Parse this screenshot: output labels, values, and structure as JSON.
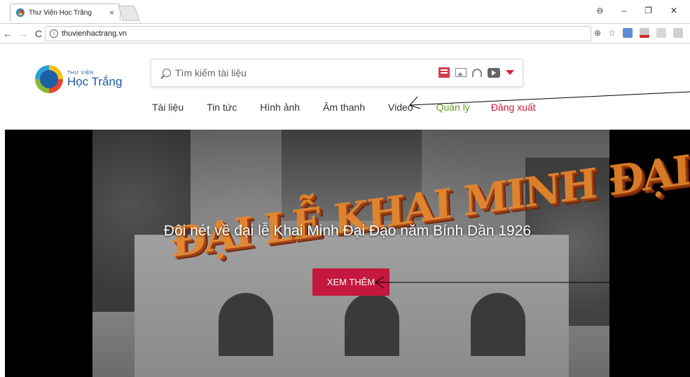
{
  "browser": {
    "tab_title": "Thư Viện Học Trắng",
    "tab_close": "×",
    "url": "thuvienhactrang.vn",
    "win_buttons": [
      "⊖",
      "–",
      "❐",
      "✕"
    ]
  },
  "site": {
    "logo_small": "THƯ VIỆN",
    "logo_big": "Học Trắng",
    "search_placeholder": "Tìm kiếm tài liệu",
    "nav": {
      "docs": "Tài liệu",
      "news": "Tin tức",
      "images": "Hình ảnh",
      "audio": "Âm thanh",
      "video": "Video",
      "manage": "Quản lý",
      "logout": "Đăng xuất"
    },
    "hero": {
      "wordart": "ĐẠI LỄ KHAI MINH ĐẠI ĐẠO",
      "title": "Đôi nét về đại lễ Khai Minh Đại Đạo năm Bính Dần 1926",
      "button": "XEM THÊM"
    }
  },
  "colors": {
    "accent_red": "#c4183f",
    "manage_green": "#6a9c1f",
    "logout_red": "#c81e3d",
    "logo_blue": "#1a5aa8"
  }
}
